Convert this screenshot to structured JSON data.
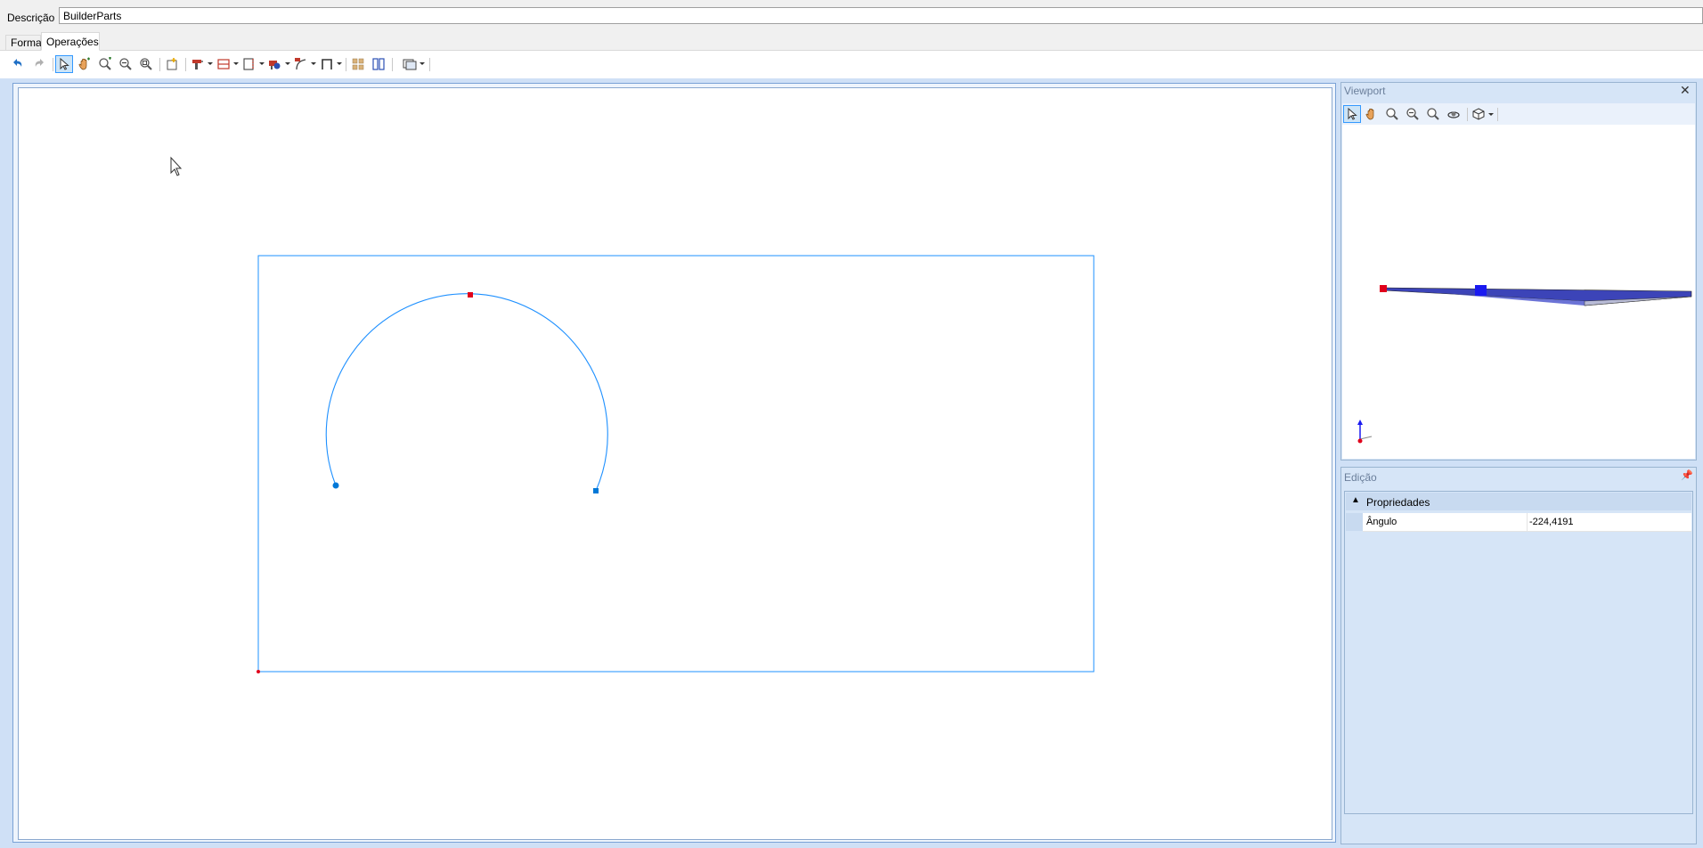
{
  "description": {
    "label": "Descrição",
    "value": "BuilderParts"
  },
  "tabs": [
    {
      "label": "Forma",
      "active": false
    },
    {
      "label": "Operações",
      "active": true
    }
  ],
  "toolbar": {
    "icons": [
      "undo-icon",
      "redo-icon",
      "select-pointer-icon",
      "pan-hand-icon",
      "zoom-window-icon",
      "zoom-out-icon",
      "zoom-extents-icon",
      "new-shape-icon",
      "drill-tool-icon",
      "layer-tool-icon",
      "profile-tool-icon",
      "routing-tool-icon",
      "path-tool-icon",
      "frame-tool-icon",
      "grid-array-icon",
      "mirror-icon",
      "view-options-icon"
    ]
  },
  "viewport_panel": {
    "title": "Viewport",
    "close": "✕",
    "toolbar_icons": [
      "select-pointer-icon",
      "pan-hand-icon",
      "zoom-window-icon",
      "zoom-out-icon",
      "zoom-extents-icon",
      "orbit-icon",
      "view-cube-icon"
    ]
  },
  "edicao_panel": {
    "title": "Edição",
    "pin": "📌",
    "category": "Propriedades",
    "toggle": "▲",
    "properties": [
      {
        "name": "Ângulo",
        "value": "-224,4191"
      }
    ]
  },
  "colors": {
    "accent": "#1e90ff",
    "handle_red": "#e0001b",
    "handle_blue": "#0078d7",
    "panel_bg": "#d6e5f7"
  }
}
